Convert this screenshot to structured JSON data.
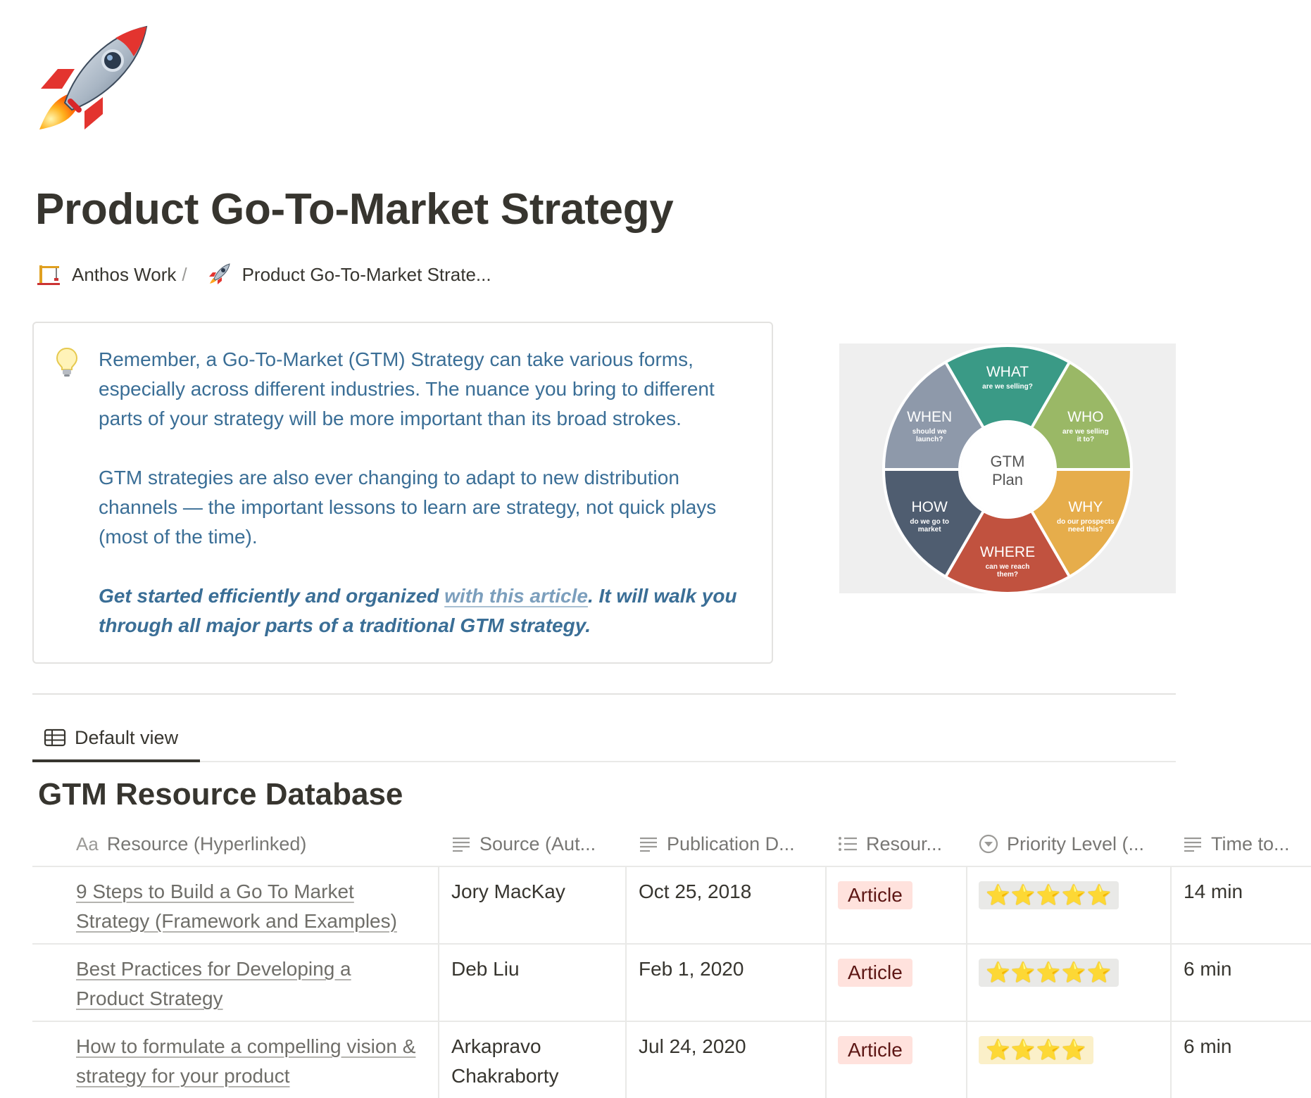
{
  "page": {
    "icon": "rocket-emoji",
    "title": "Product Go-To-Market Strategy"
  },
  "breadcrumb": {
    "items": [
      {
        "icon": "construction-crane-emoji",
        "label": "Anthos Work"
      },
      {
        "icon": "rocket-emoji",
        "label": "Product Go-To-Market Strate..."
      }
    ],
    "separator": "/"
  },
  "callout": {
    "icon": "lightbulb-icon",
    "paragraph1": "Remember, a Go-To-Market (GTM) Strategy can take various forms, especially across different industries. The nuance you bring to different parts of your strategy will be more important than its broad strokes.",
    "paragraph2": "GTM strategies are also ever changing to adapt to new distribution channels — the important lessons to learn are strategy, not quick plays (most of the time).",
    "cta_before": "Get started efficiently and organized ",
    "cta_link": "with this article",
    "cta_after": ". It will walk you through all major parts of a traditional GTM strategy."
  },
  "gtm_diagram": {
    "center": [
      "GTM",
      "Plan"
    ],
    "segments": [
      {
        "title": "WHAT",
        "sub": [
          "are we selling?"
        ],
        "color": "#3a9a86"
      },
      {
        "title": "WHO",
        "sub": [
          "are we selling",
          "it to?"
        ],
        "color": "#9ab866"
      },
      {
        "title": "WHY",
        "sub": [
          "do our prospects",
          "need this?"
        ],
        "color": "#e6ad4b"
      },
      {
        "title": "WHERE",
        "sub": [
          "can we reach",
          "them?"
        ],
        "color": "#c1523f"
      },
      {
        "title": "HOW",
        "sub": [
          "do we go to",
          "market"
        ],
        "color": "#4f5d70"
      },
      {
        "title": "WHEN",
        "sub": [
          "should we",
          "launch?"
        ],
        "color": "#8e99aa"
      }
    ]
  },
  "view_tab": {
    "icon": "table-icon",
    "label": "Default view"
  },
  "database": {
    "title": "GTM Resource Database",
    "columns": [
      {
        "icon": "title-aa-icon",
        "label": "Resource (Hyperlinked)"
      },
      {
        "icon": "text-lines-icon",
        "label": "Source (Aut..."
      },
      {
        "icon": "text-lines-icon",
        "label": "Publication D..."
      },
      {
        "icon": "multi-select-icon",
        "label": "Resour..."
      },
      {
        "icon": "select-chevron-icon",
        "label": "Priority Level (..."
      },
      {
        "icon": "text-lines-icon",
        "label": "Time to..."
      }
    ],
    "rows": [
      {
        "resource": "9 Steps to Build a Go To Market Strategy (Framework and Examples)",
        "source": "Jory MacKay",
        "date": "Oct 25, 2018",
        "type": "Article",
        "priority": "⭐⭐⭐⭐⭐",
        "priority_count": 5,
        "priority_bg": "#e9e9e7",
        "time": "14 min"
      },
      {
        "resource": "Best Practices for Developing a Product Strategy",
        "source": "Deb Liu",
        "date": "Feb 1, 2020",
        "type": "Article",
        "priority": "⭐⭐⭐⭐⭐",
        "priority_count": 5,
        "priority_bg": "#e9e9e7",
        "time": "6 min"
      },
      {
        "resource": "How to formulate a compelling vision & strategy for your product",
        "source": "Arkapravo Chakraborty",
        "date": "Jul 24, 2020",
        "type": "Article",
        "priority": "⭐⭐⭐⭐",
        "priority_count": 4,
        "priority_bg": "#fbf0c9",
        "time": "6 min"
      }
    ]
  }
}
